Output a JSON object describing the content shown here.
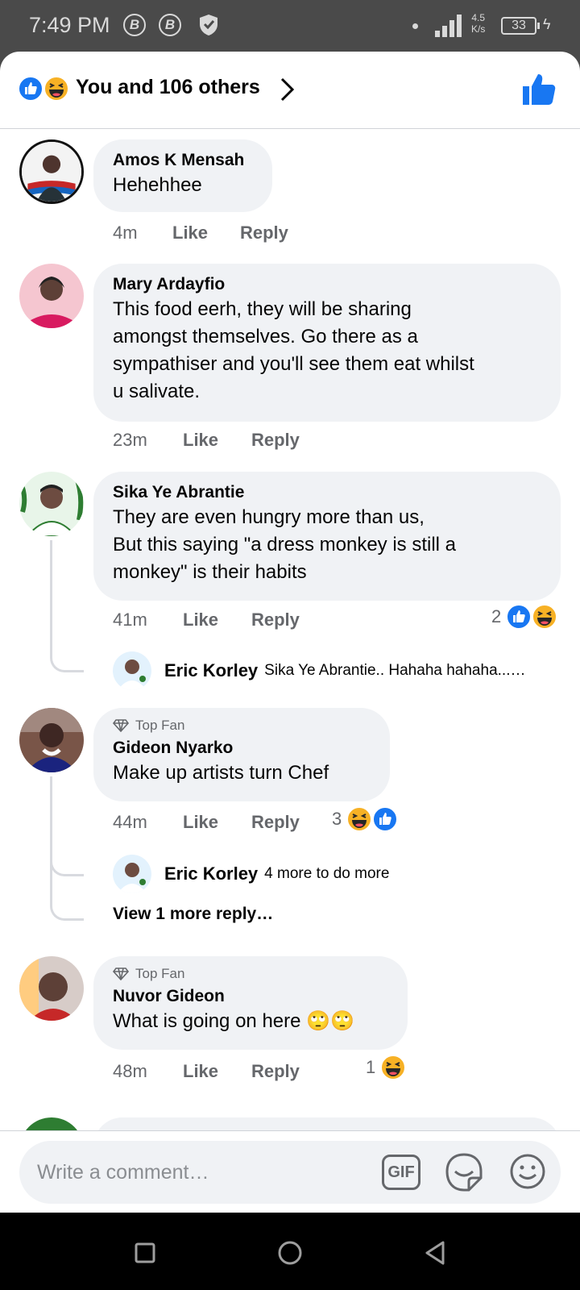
{
  "status_bar": {
    "time": "7:49 PM",
    "icon_b1": "B",
    "icon_b2": "B",
    "net_speed_value": "4.5",
    "net_speed_unit": "K/s",
    "battery": "33"
  },
  "header": {
    "reactions_text": "You and 106 others",
    "icons": [
      "like-icon",
      "haha-icon",
      "chevron-right-icon",
      "thumbs-up-icon"
    ]
  },
  "comments": [
    {
      "author": "Amos K Mensah",
      "text": "Hehehhee",
      "time": "4m",
      "like": "Like",
      "reply": "Reply"
    },
    {
      "author": "Mary Ardayfio",
      "text_lines": [
        "This food  eerh, they  will  be  sharing",
        "amongst themselves.  Go there as a",
        "sympathiser and  you'll see them  eat whilst",
        "u salivate."
      ],
      "time": "23m",
      "like": "Like",
      "reply": "Reply"
    },
    {
      "author": "Sika Ye Abrantie",
      "text_lines": [
        "They are even hungry more than us,",
        "But this saying \"a dress monkey is still a",
        "monkey\" is their habits"
      ],
      "time": "41m",
      "like": "Like",
      "reply": "Reply",
      "reaction_count": "2",
      "reply_preview": {
        "author": "Eric Korley",
        "text": "Sika Ye Abrantie.. Hahaha hahaha...…"
      }
    },
    {
      "badge": "Top Fan",
      "author": "Gideon Nyarko",
      "text": "Make up artists turn Chef",
      "time": "44m",
      "like": "Like",
      "reply": "Reply",
      "reaction_count": "3",
      "reply_preview": {
        "author": "Eric Korley",
        "text": "4 more to do more"
      },
      "view_more": "View 1 more reply…"
    },
    {
      "badge": "Top Fan",
      "author": "Nuvor Gideon",
      "text": "What is going on here 🙄🙄",
      "time": "48m",
      "like": "Like",
      "reply": "Reply",
      "reaction_count": "1"
    }
  ],
  "composer": {
    "placeholder": "Write a comment…",
    "gif_label": "GIF"
  },
  "colors": {
    "facebook_blue": "#1877f2",
    "bubble_bg": "#f0f2f5",
    "meta_gray": "#65676b",
    "haha_yellow": "#f7b125"
  }
}
